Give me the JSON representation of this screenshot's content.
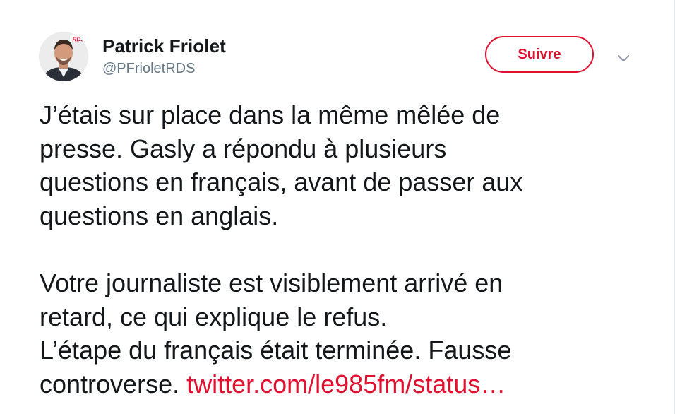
{
  "author": {
    "name": "Patrick Friolet",
    "handle": "@PFrioletRDS",
    "avatar_badge": "RDS"
  },
  "follow_button": {
    "label": "Suivre"
  },
  "menu": {
    "icon": "chevron-down-icon"
  },
  "tweet": {
    "paragraph1": [
      "J’étais sur place dans la même mêlée de",
      "presse. Gasly a répondu à plusieurs",
      "questions en français, avant de passer aux",
      "questions en anglais."
    ],
    "paragraph2": [
      "Votre journaliste est visiblement arrivé en",
      "retard, ce qui explique le refus.",
      "L’étape du français était terminée. Fausse"
    ],
    "last_line_text": "controverse. ",
    "link_text": "twitter.com/le985fm/status…"
  },
  "colors": {
    "accent": "#e0102f",
    "text": "#14171a",
    "secondary_text": "#657786"
  }
}
